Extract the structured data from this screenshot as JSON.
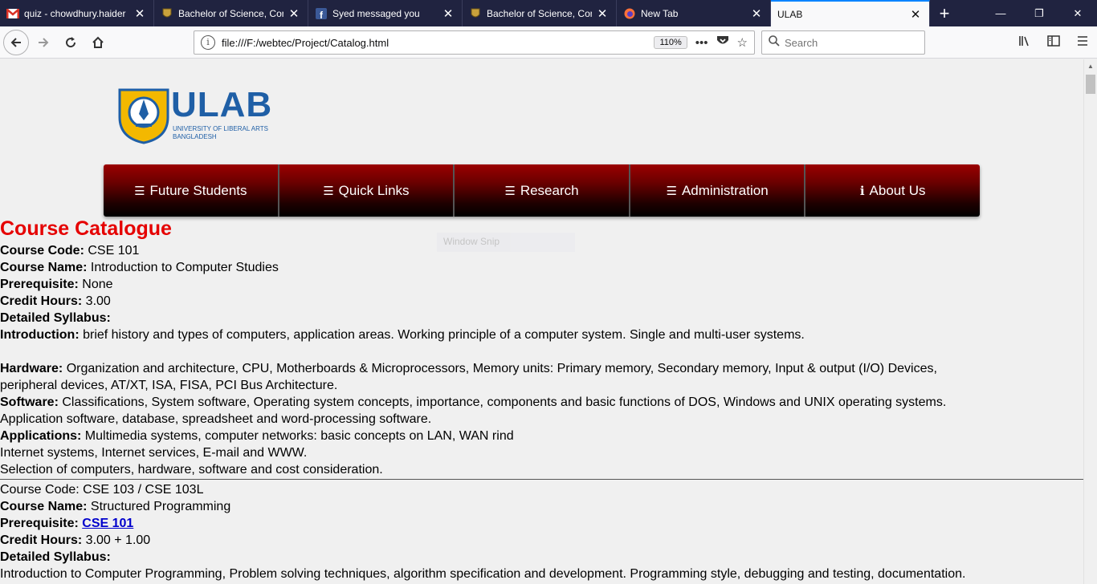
{
  "tabs": [
    {
      "title": "quiz - chowdhury.haider",
      "icon": "gmail-icon",
      "active": false
    },
    {
      "title": "Bachelor of Science, Con",
      "icon": "ulab-crest-icon",
      "active": false
    },
    {
      "title": "Syed messaged you",
      "icon": "facebook-icon",
      "active": false
    },
    {
      "title": "Bachelor of Science, Con",
      "icon": "ulab-crest-icon",
      "active": false
    },
    {
      "title": "New Tab",
      "icon": "firefox-icon",
      "active": false
    },
    {
      "title": "ULAB",
      "icon": "",
      "active": true
    }
  ],
  "browser": {
    "url": "file:///F:/webtec/Project/Catalog.html",
    "zoom": "110%",
    "search_placeholder": "Search"
  },
  "site": {
    "logo_text": "ULAB",
    "logo_subtext_1": "UNIVERSITY OF LIBERAL ARTS",
    "logo_subtext_2": "BANGLADESH",
    "menu": [
      {
        "label": "Future Students",
        "icon": "list-icon"
      },
      {
        "label": "Quick Links",
        "icon": "list-icon"
      },
      {
        "label": "Research",
        "icon": "list-icon"
      },
      {
        "label": "Administration",
        "icon": "list-icon"
      },
      {
        "label": "About Us",
        "icon": "info-icon"
      }
    ],
    "ghost_text": "Window Snip"
  },
  "catalog": {
    "title": "Course Catalogue",
    "course1": {
      "code_label": "Course Code:",
      "code": " CSE 101",
      "name_label": "Course Name:",
      "name": " Introduction to Computer Studies",
      "prereq_label": "Prerequisite:",
      "prereq": " None",
      "credit_label": "Credit Hours:",
      "credit": " 3.00",
      "syllabus_label": "Detailed Syllabus:",
      "intro_label": "Introduction:",
      "intro": " brief history and types of computers, application areas. Working principle of a computer system. Single and multi-user systems.",
      "hardware_label": "Hardware:",
      "hardware_1": " Organization and architecture, CPU, Motherboards & Microprocessors, Memory units: Primary memory, Secondary memory, Input & output (I/O) Devices,",
      "hardware_2": "peripheral devices, AT/XT, ISA, FISA, PCI Bus Architecture.",
      "software_label": "Software:",
      "software_1": " Classifications, System software, Operating system concepts, importance, components and basic functions of DOS, Windows and UNIX operating systems.",
      "software_2": "Application software, database, spreadsheet and word-processing software.",
      "apps_label": "Applications:",
      "apps_1": " Multimedia systems, computer networks: basic concepts on LAN, WAN rind",
      "apps_2": "Internet systems, Internet services, E-mail and WWW.",
      "apps_3": "Selection of computers, hardware, software and cost consideration."
    },
    "course2": {
      "code_line": "Course Code: CSE 103 / CSE 103L",
      "name_label": "Course Name:",
      "name": " Structured Programming",
      "prereq_label": "Prerequisite: ",
      "prereq_link": "CSE 101",
      "credit_label": "Credit Hours:",
      "credit": " 3.00 + 1.00",
      "syllabus_label": "Detailed Syllabus:",
      "syllabus_1": "Introduction to Computer Programming, Problem solving techniques, algorithm specification and development. Programming style, debugging and testing, documentation."
    }
  }
}
